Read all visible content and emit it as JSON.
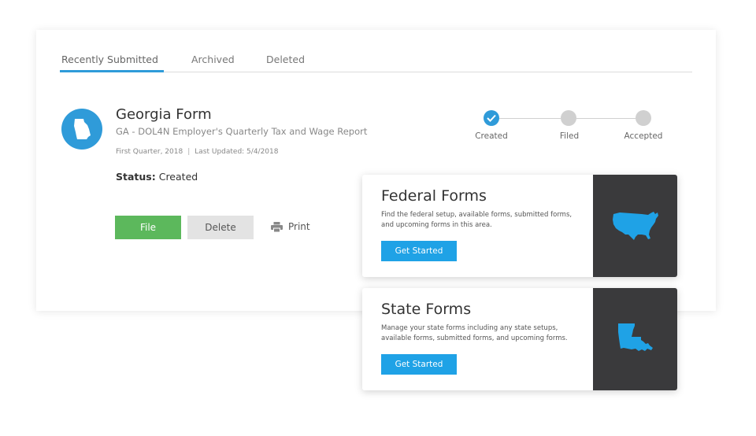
{
  "tabs": [
    {
      "label": "Recently Submitted",
      "active": true
    },
    {
      "label": "Archived",
      "active": false
    },
    {
      "label": "Deleted",
      "active": false
    }
  ],
  "form": {
    "title": "Georgia Form",
    "subtitle": "GA - DOL4N Employer's Quarterly Tax and Wage Report",
    "period": "First Quarter, 2018",
    "separator": "|",
    "last_updated": "Last Updated: 5/4/2018",
    "status_label": "Status:",
    "status_value": "Created",
    "state_icon": "georgia-state-icon"
  },
  "actions": {
    "file_label": "File",
    "delete_label": "Delete",
    "print_label": "Print"
  },
  "progress": {
    "steps": [
      {
        "label": "Created",
        "complete": true
      },
      {
        "label": "Filed",
        "complete": false
      },
      {
        "label": "Accepted",
        "complete": false
      }
    ]
  },
  "promos": [
    {
      "title": "Federal Forms",
      "text": "Find the federal setup, available forms, submitted forms, and upcoming forms in this area.",
      "button_label": "Get Started",
      "icon": "usa-map-icon"
    },
    {
      "title": "State Forms",
      "text": "Manage your state forms including any state setups, available forms, submitted forms, and upcoming forms.",
      "button_label": "Get Started",
      "icon": "louisiana-map-icon"
    }
  ],
  "colors": {
    "accent": "#2f9bd9",
    "file_button": "#5cb85c",
    "delete_button": "#e3e3e3",
    "promo_button": "#1fa2e6",
    "promo_panel": "#3a3a3c",
    "step_inactive": "#d0d0d0"
  }
}
